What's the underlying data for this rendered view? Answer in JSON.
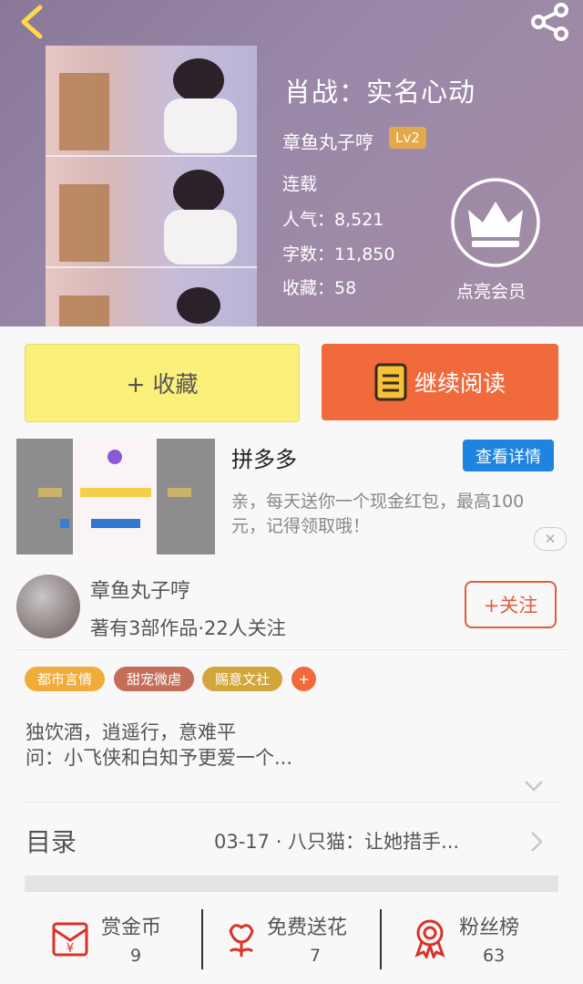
{
  "book": {
    "title": "肖战：实名心动",
    "author": "章鱼丸子哼",
    "level": "Lv2",
    "status": "连载",
    "popularity": "人气：8,521",
    "word_count": "字数：11,850",
    "favorites": "收藏：58",
    "vip_label": "点亮会员"
  },
  "actions": {
    "favorite": "+ 收藏",
    "continue": "继续阅读"
  },
  "ad": {
    "title": "拼多多",
    "details_button": "查看详情",
    "description": "亲，每天送你一个现金红包，最高100元，记得领取哦！",
    "close": "✕"
  },
  "author_row": {
    "name": "章鱼丸子哼",
    "info": "著有3部作品·22人关注",
    "follow": "+关注"
  },
  "tags": [
    {
      "label": "都市言情",
      "color": "#f0ac3a"
    },
    {
      "label": "甜宠微虐",
      "color": "#c36e58"
    },
    {
      "label": "赐意文社",
      "color": "#d3a63c"
    },
    {
      "label": "+",
      "color": "#f06a3c"
    }
  ],
  "synopsis": {
    "line1": "独饮酒，逍遥行，意难平",
    "line2": "问：小飞侠和白知予更爱一个..."
  },
  "toc": {
    "label": "目录",
    "latest": "03-17 · 八只猫：让她措手..."
  },
  "stats": [
    {
      "label": "赏金币",
      "value": "9",
      "icon": "red-envelope-icon"
    },
    {
      "label": "免费送花",
      "value": "7",
      "icon": "flower-icon"
    },
    {
      "label": "粉丝榜",
      "value": "63",
      "icon": "medal-icon"
    }
  ],
  "colors": {
    "accent": "#f06a3c",
    "favorite_btn": "#fbf07a",
    "ad_btn": "#1f83e0",
    "icon_red": "#d9322a"
  }
}
